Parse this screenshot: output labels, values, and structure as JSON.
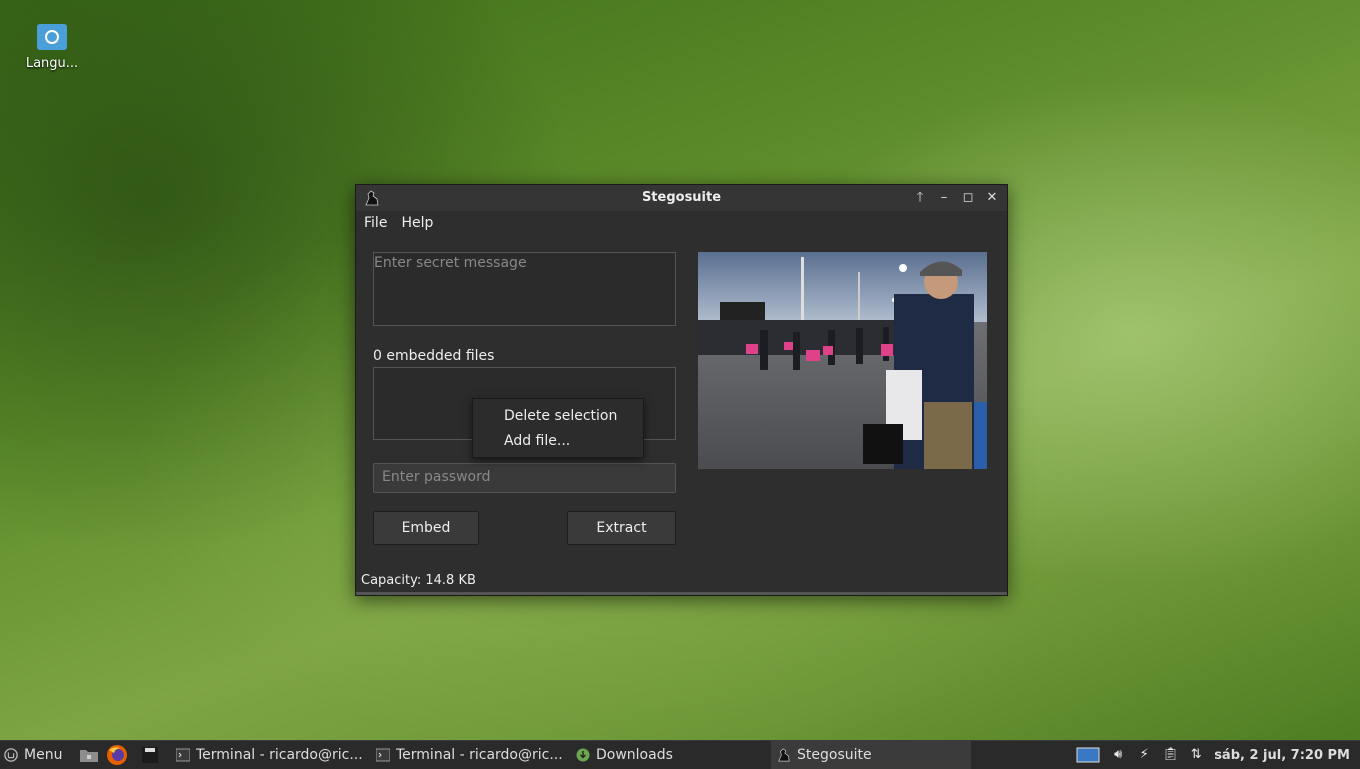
{
  "desktop": {
    "icon_label": "Langu..."
  },
  "window": {
    "title": "Stegosuite",
    "menus": [
      "File",
      "Help"
    ],
    "message_placeholder": "Enter secret message",
    "embedded_files_label": "0 embedded files",
    "password_placeholder": "Enter password",
    "embed_label": "Embed",
    "extract_label": "Extract",
    "capacity": "Capacity: 14.8 KB"
  },
  "context_menu": {
    "items": [
      "Delete selection",
      "Add file..."
    ]
  },
  "taskbar": {
    "menu_label": "Menu",
    "tasks": [
      "Terminal - ricardo@ric...",
      "Terminal - ricardo@ric...",
      "Downloads",
      "Stegosuite"
    ],
    "datetime": "sáb,  2 jul,  7:20 PM"
  },
  "colors": {
    "window_bg": "#2e2e2e",
    "taskbar_bg": "#2a2a2a",
    "downloads_icon": "#6aa84f"
  }
}
